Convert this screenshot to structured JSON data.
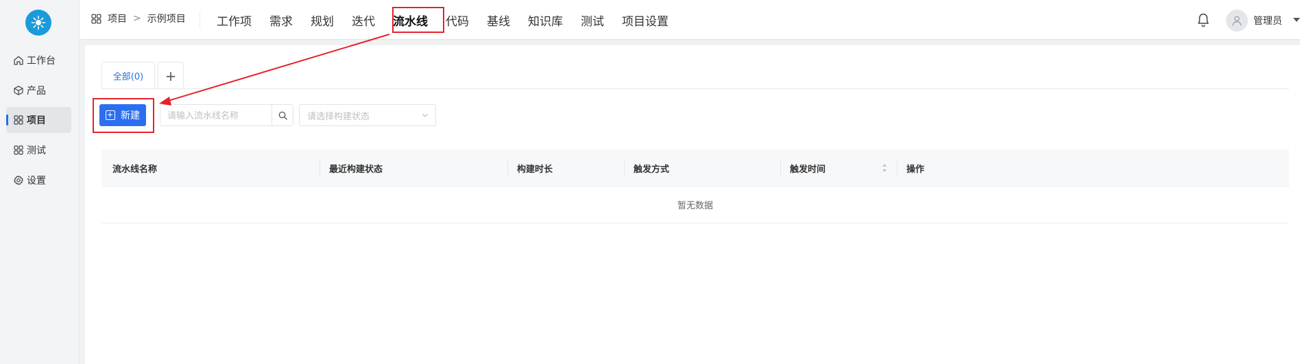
{
  "sidebar": {
    "logo": "app-logo",
    "items": [
      {
        "label": "工作台",
        "icon": "home-icon"
      },
      {
        "label": "产品",
        "icon": "cube-icon"
      },
      {
        "label": "项目",
        "icon": "grid-icon",
        "active": true
      },
      {
        "label": "测试",
        "icon": "grid-icon"
      },
      {
        "label": "设置",
        "icon": "gear-icon"
      }
    ]
  },
  "header": {
    "breadcrumb": {
      "root": "项目",
      "separator": ">",
      "current": "示例项目"
    },
    "tabs": [
      "工作项",
      "需求",
      "规划",
      "迭代",
      "流水线",
      "代码",
      "基线",
      "知识库",
      "测试",
      "项目设置"
    ],
    "active_tab": "流水线",
    "user": {
      "name": "管理员"
    }
  },
  "main": {
    "tab_all": "全部(0)",
    "tab_add": "+",
    "new_button": "新建",
    "search": {
      "placeholder": "请输入流水线名称",
      "value": ""
    },
    "status_select": {
      "placeholder": "请选择构建状态"
    },
    "table": {
      "columns": [
        "流水线名称",
        "最近构建状态",
        "构建时长",
        "触发方式",
        "触发时间",
        "操作"
      ],
      "rows": [],
      "empty_text": "暂无数据"
    }
  },
  "colors": {
    "primary": "#2b6ff0",
    "annotation_red": "#e8202a",
    "logo": "#1a9bdc"
  }
}
